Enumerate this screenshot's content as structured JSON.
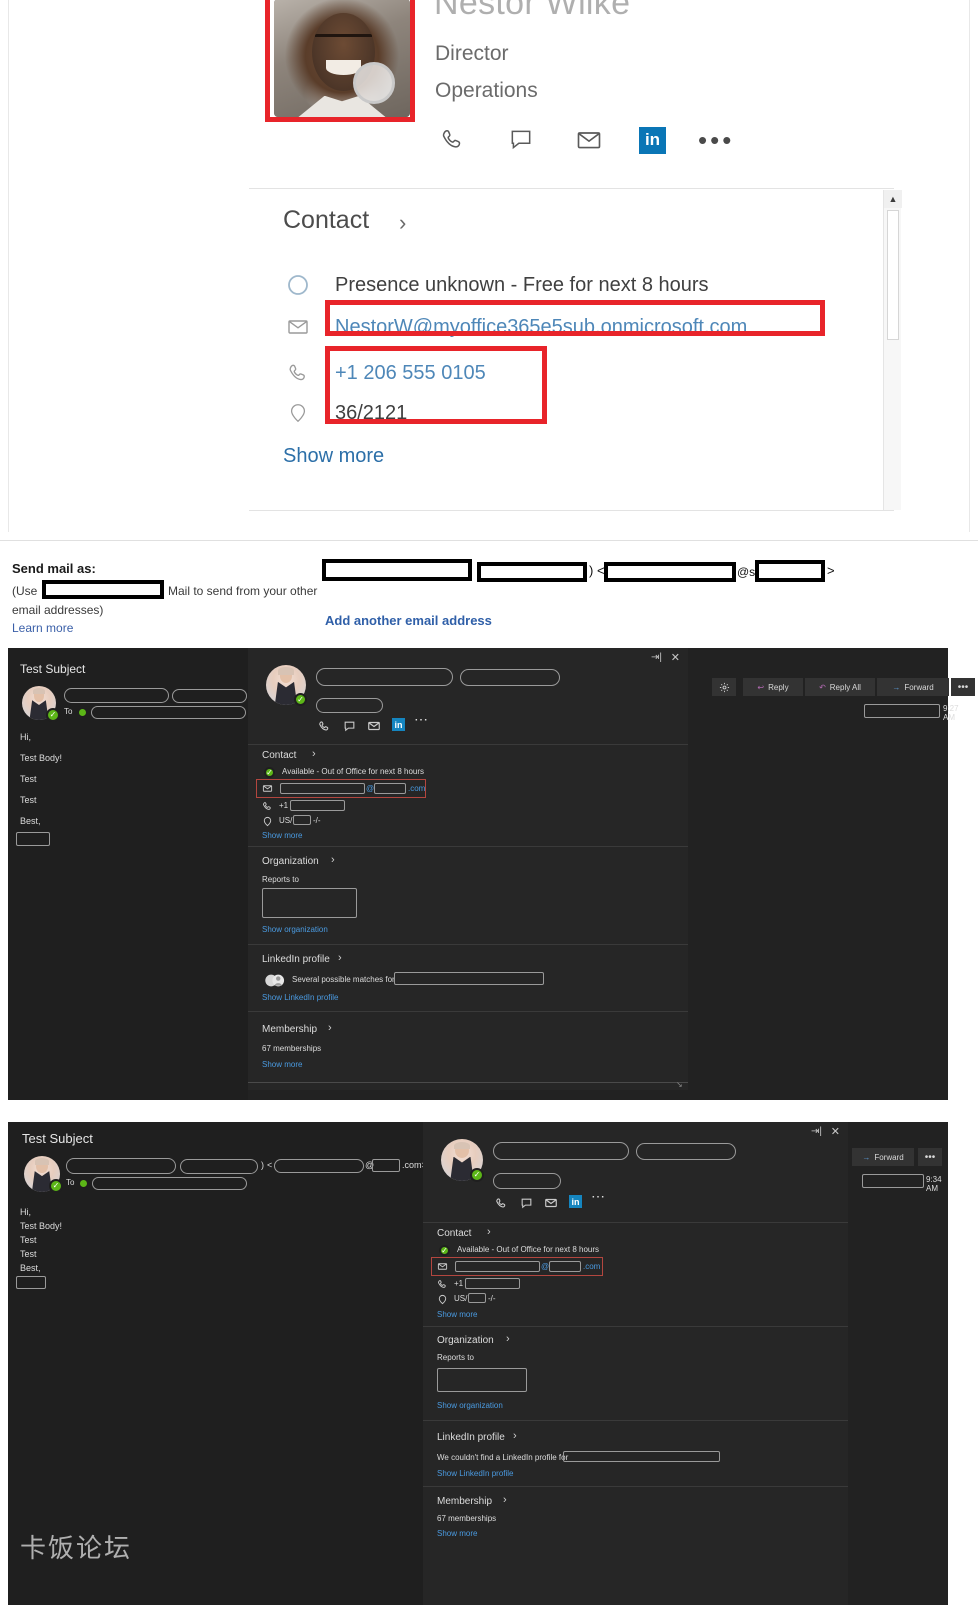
{
  "contact_card_light": {
    "name": "Nestor Wilke",
    "job_title": "Director",
    "department": "Operations",
    "actions": [
      {
        "icon": "phone-icon",
        "label": "Call"
      },
      {
        "icon": "chat-icon",
        "label": "Chat"
      },
      {
        "icon": "mail-icon",
        "label": "Email"
      },
      {
        "icon": "linkedin-icon",
        "label": "in"
      },
      {
        "icon": "more-icon",
        "label": "•••"
      }
    ],
    "section_title": "Contact",
    "chevron": "›",
    "presence": "Presence unknown - Free for next 8 hours",
    "email": "NestorW@myoffice365e5sub.onmicrosoft.com",
    "phone": "+1 206 555 0105",
    "office": "36/2121",
    "show_more": "Show more",
    "highlight_color": "#e8242a",
    "link_color": "#4e87b8"
  },
  "send_mail_as": {
    "label": "Send mail as:",
    "use_prefix": "(Use",
    "use_suffix": "Mail to send from your other",
    "line2": "email addresses)",
    "learn_more": "Learn more",
    "add_another": "Add another email address",
    "at_symbol": "@s",
    "paren_close": ")",
    "angle_open": "<",
    "angle_close": ">"
  },
  "middle_panel": {
    "subject": "Test Subject",
    "to_label": "To",
    "body_lines": [
      "Hi,",
      "Test Body!",
      "Test",
      "Test",
      "Best,"
    ],
    "toolbar": {
      "settings_icon": "gear-icon",
      "reply": "Reply",
      "reply_all": "Reply All",
      "forward": "Forward",
      "more": "•••",
      "timestamp": "9:27 AM"
    },
    "window_controls": {
      "popout": "pop-out-icon",
      "close": "✕"
    },
    "card": {
      "actions": [
        "phone-icon",
        "chat-icon",
        "mail-icon",
        "linkedin-icon",
        "more-icon"
      ],
      "sections": [
        {
          "id": "contact",
          "title": "Contact",
          "chevron": "›",
          "presence": "Available - Out of Office for next 8 hours",
          "email_at": "@",
          "email_tld": ".com",
          "phone_prefix": "+1",
          "location_prefix": "US/",
          "location_suffix": "-/-",
          "show_more": "Show more"
        },
        {
          "id": "organization",
          "title": "Organization",
          "chevron": "›",
          "reports_to": "Reports to",
          "show_organization": "Show organization"
        },
        {
          "id": "linkedin",
          "title": "LinkedIn profile",
          "chevron": "›",
          "status": "Several possible matches for",
          "show_linkedin": "Show LinkedIn profile"
        },
        {
          "id": "membership",
          "title": "Membership",
          "chevron": "›",
          "count": "67 memberships",
          "show_more": "Show more"
        }
      ]
    }
  },
  "bottom_panel": {
    "subject": "Test Subject",
    "to_label": "To",
    "body_lines": [
      "Hi,",
      "Test Body!",
      "Test",
      "Test",
      "Best,"
    ],
    "email_at": "@",
    "email_tld": ".com>",
    "angle_open": "<",
    "paren_close": ")",
    "toolbar": {
      "forward": "Forward",
      "more": "•••",
      "timestamp": "9:34 AM"
    },
    "window_controls": {
      "popout": "pop-out-icon",
      "close": "✕"
    },
    "card": {
      "actions": [
        "phone-icon",
        "chat-icon",
        "mail-icon",
        "linkedin-icon",
        "more-icon"
      ],
      "sections": [
        {
          "id": "contact",
          "title": "Contact",
          "chevron": "›",
          "presence": "Available - Out of Office for next 8 hours",
          "email_at": "@",
          "email_tld": ".com",
          "phone_prefix": "+1",
          "location_prefix": "US/",
          "location_suffix": "-/-",
          "show_more": "Show more"
        },
        {
          "id": "organization",
          "title": "Organization",
          "chevron": "›",
          "reports_to": "Reports to",
          "show_organization": "Show organization"
        },
        {
          "id": "linkedin",
          "title": "LinkedIn profile",
          "chevron": "›",
          "status": "We couldn't find a LinkedIn profile for",
          "show_linkedin": "Show LinkedIn profile"
        },
        {
          "id": "membership",
          "title": "Membership",
          "chevron": "›",
          "count": "67 memberships",
          "show_more": "Show more"
        }
      ]
    }
  },
  "watermark": "卡饭论坛"
}
